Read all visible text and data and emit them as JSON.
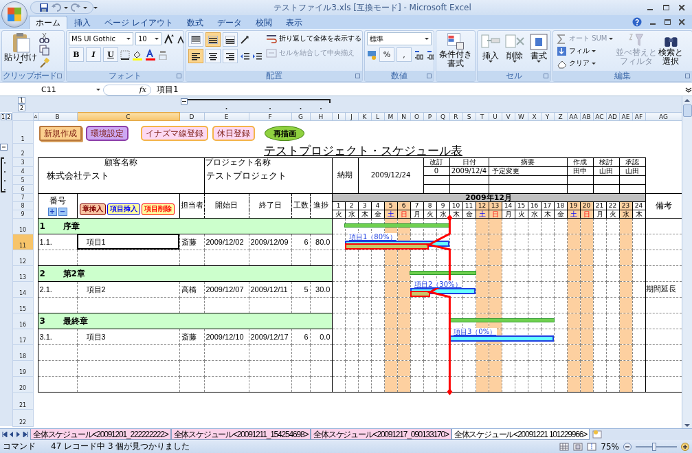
{
  "window": {
    "title": "テストファイル3.xls  [互換モード] - Microsoft Excel"
  },
  "ribbon": {
    "tabs": [
      {
        "label": "ホーム",
        "selected": true
      },
      {
        "label": "挿入",
        "selected": false
      },
      {
        "label": "ページ レイアウト",
        "selected": false
      },
      {
        "label": "数式",
        "selected": false
      },
      {
        "label": "データ",
        "selected": false
      },
      {
        "label": "校閲",
        "selected": false
      },
      {
        "label": "表示",
        "selected": false
      }
    ],
    "groups": [
      {
        "kind": "clipboard",
        "label": "クリップボード",
        "paste": "貼り付け"
      },
      {
        "kind": "font",
        "label": "フォント",
        "font_name": "MS UI Gothic",
        "font_size": "10",
        "styles": [
          "B",
          "I",
          "U"
        ]
      },
      {
        "kind": "alignment",
        "label": "配置",
        "vertical": [
          {
            "kind": "top",
            "selected": false
          },
          {
            "kind": "middle",
            "selected": true
          },
          {
            "kind": "bottom",
            "selected": false
          }
        ],
        "horizontal": [
          {
            "kind": "left",
            "selected": true
          },
          {
            "kind": "center",
            "selected": false
          },
          {
            "kind": "right",
            "selected": false
          }
        ],
        "wrap": {
          "label": "折り返して全体を表示する",
          "disabled": false
        },
        "merge": {
          "label": "セルを結合して中央揃え",
          "disabled": true
        }
      },
      {
        "kind": "number",
        "label": "数値",
        "format": "標準",
        "symbols": [
          "%",
          ","
        ]
      },
      {
        "kind": "styles",
        "button": "条件付き書式"
      },
      {
        "kind": "cells",
        "label": "セル",
        "buttons": [
          "挿入",
          "削除",
          "書式"
        ]
      },
      {
        "kind": "editing",
        "label": "編集",
        "items": [
          {
            "label": "オート SUM",
            "disabled": true
          },
          {
            "label": "フィル",
            "disabled": false
          },
          {
            "label": "クリア",
            "disabled": false
          }
        ],
        "buttons": [
          {
            "label": "並べ替えとフィルタ",
            "disabled": true
          },
          {
            "label": "検索と選択",
            "disabled": false
          }
        ]
      }
    ]
  },
  "formula_bar": {
    "name_box": "C11",
    "function_label": "fx",
    "value": "項目1"
  },
  "sheet": {
    "outline": {
      "column_levels": [
        "1",
        "2"
      ],
      "row_levels": [
        "1",
        "2"
      ]
    },
    "columns": [
      {
        "label": "A",
        "selected": false
      },
      {
        "label": "B",
        "selected": false
      },
      {
        "label": "C",
        "selected": true
      },
      {
        "label": "D",
        "selected": false
      },
      {
        "label": "E",
        "selected": false
      },
      {
        "label": "F",
        "selected": false
      },
      {
        "label": "G",
        "selected": false
      },
      {
        "label": "H",
        "selected": false
      },
      {
        "label": "I",
        "selected": false
      },
      {
        "label": "J",
        "selected": false
      },
      {
        "label": "K",
        "selected": false
      },
      {
        "label": "L",
        "selected": false
      },
      {
        "label": "M",
        "selected": false
      },
      {
        "label": "N",
        "selected": false
      },
      {
        "label": "O",
        "selected": false
      },
      {
        "label": "P",
        "selected": false
      },
      {
        "label": "Q",
        "selected": false
      },
      {
        "label": "R",
        "selected": false
      },
      {
        "label": "S",
        "selected": false
      },
      {
        "label": "T",
        "selected": false
      },
      {
        "label": "U",
        "selected": false
      },
      {
        "label": "V",
        "selected": false
      },
      {
        "label": "W",
        "selected": false
      },
      {
        "label": "X",
        "selected": false
      },
      {
        "label": "Y",
        "selected": false
      },
      {
        "label": "Z",
        "selected": false
      },
      {
        "label": "AA",
        "selected": false
      },
      {
        "label": "AB",
        "selected": false
      },
      {
        "label": "AC",
        "selected": false
      },
      {
        "label": "AD",
        "selected": false
      },
      {
        "label": "AE",
        "selected": false
      },
      {
        "label": "AF",
        "selected": false
      },
      {
        "label": "AG",
        "selected": false
      }
    ],
    "rows": [
      {
        "label": "1",
        "selected": false
      },
      {
        "label": "2",
        "selected": false
      },
      {
        "label": "3",
        "selected": false
      },
      {
        "label": "4",
        "selected": false
      },
      {
        "label": "5",
        "selected": false
      },
      {
        "label": "6",
        "selected": false
      },
      {
        "label": "7",
        "selected": false
      },
      {
        "label": "8",
        "selected": false
      },
      {
        "label": "9",
        "selected": false
      },
      {
        "label": "10",
        "selected": false
      },
      {
        "label": "11",
        "selected": true
      },
      {
        "label": "12",
        "selected": false
      },
      {
        "label": "13",
        "selected": false
      },
      {
        "label": "14",
        "selected": false
      },
      {
        "label": "15",
        "selected": false
      },
      {
        "label": "16",
        "selected": false
      },
      {
        "label": "17",
        "selected": false
      },
      {
        "label": "18",
        "selected": false
      },
      {
        "label": "19",
        "selected": false
      },
      {
        "label": "20",
        "selected": false
      },
      {
        "label": "21",
        "selected": false
      },
      {
        "label": "22",
        "selected": false
      }
    ],
    "macro_buttons": [
      {
        "label": "新規作成",
        "kind": "scroll",
        "color": "#fbd08e"
      },
      {
        "label": "環境設定",
        "kind": "rounded",
        "color": "#cda8f2"
      },
      {
        "label": "イナズマ線登録",
        "kind": "rounded",
        "color": "#fdd9f3"
      },
      {
        "label": "休日登録",
        "kind": "rounded",
        "color": "#fdd9f3"
      },
      {
        "label": "再描画",
        "kind": "ellipse",
        "color": "#8fd13f"
      }
    ],
    "title": "テストプロジェクト・スケジュール表",
    "info": {
      "customer_label": "顧客名称",
      "customer": "株式会社テスト",
      "project_label": "プロジェクト名称",
      "project": "テストプロジェクト",
      "deadline_label": "納期",
      "deadline": "2009/12/24"
    },
    "revisions": {
      "headers": [
        "改訂",
        "日付",
        "摘要",
        "作成",
        "検討",
        "承認"
      ],
      "entries": [
        [
          "0",
          "2009/12/4",
          "予定変更",
          "田中",
          "山田",
          "山田"
        ]
      ]
    },
    "task_header": {
      "number": "番号",
      "expand": "+",
      "collapse": "−",
      "row_buttons": [
        {
          "label": "章挿入",
          "kind": "chapter",
          "color": "#800000"
        },
        {
          "label": "項目挿入",
          "kind": "item",
          "color": "#0000ff"
        },
        {
          "label": "項目削除",
          "kind": "item",
          "color": "#ff0000"
        }
      ],
      "columns": [
        "担当者",
        "開始日",
        "終了日",
        "工数",
        "進捗"
      ],
      "remarks": "備考"
    },
    "calendar": {
      "month": "2009年12月",
      "days": [
        {
          "day": "1",
          "weekday": "火",
          "kind": "weekday"
        },
        {
          "day": "2",
          "weekday": "水",
          "kind": "weekday"
        },
        {
          "day": "3",
          "weekday": "木",
          "kind": "weekday"
        },
        {
          "day": "4",
          "weekday": "金",
          "kind": "weekday"
        },
        {
          "day": "5",
          "weekday": "土",
          "kind": "saturday"
        },
        {
          "day": "6",
          "weekday": "日",
          "kind": "sunday"
        },
        {
          "day": "7",
          "weekday": "月",
          "kind": "weekday"
        },
        {
          "day": "8",
          "weekday": "火",
          "kind": "weekday"
        },
        {
          "day": "9",
          "weekday": "水",
          "kind": "weekday"
        },
        {
          "day": "10",
          "weekday": "木",
          "kind": "weekday"
        },
        {
          "day": "11",
          "weekday": "金",
          "kind": "weekday"
        },
        {
          "day": "12",
          "weekday": "土",
          "kind": "saturday"
        },
        {
          "day": "13",
          "weekday": "日",
          "kind": "sunday"
        },
        {
          "day": "14",
          "weekday": "月",
          "kind": "weekday"
        },
        {
          "day": "15",
          "weekday": "火",
          "kind": "weekday"
        },
        {
          "day": "16",
          "weekday": "水",
          "kind": "weekday"
        },
        {
          "day": "17",
          "weekday": "木",
          "kind": "weekday"
        },
        {
          "day": "18",
          "weekday": "金",
          "kind": "weekday"
        },
        {
          "day": "19",
          "weekday": "土",
          "kind": "saturday"
        },
        {
          "day": "20",
          "weekday": "日",
          "kind": "sunday"
        },
        {
          "day": "21",
          "weekday": "月",
          "kind": "weekday"
        },
        {
          "day": "22",
          "weekday": "火",
          "kind": "weekday"
        },
        {
          "day": "23",
          "weekday": "水",
          "kind": "holiday"
        },
        {
          "day": "24",
          "weekday": "木",
          "kind": "weekday"
        }
      ]
    },
    "chapters": [
      {
        "number": "1",
        "name": "序章",
        "selected": false,
        "children": [
          {
            "number": "1.1.",
            "name": "項目1",
            "assignee": "斎藤",
            "start": "2009/12/02",
            "end": "2009/12/09",
            "effort": "6",
            "progress": "80.0",
            "level": 0.8,
            "bar_label": "項目1（80%）",
            "selected": true
          }
        ]
      },
      {
        "number": "2",
        "name": "第2章",
        "selected": false,
        "children": [
          {
            "number": "2.1.",
            "name": "項目2",
            "assignee": "高橋",
            "start": "2009/12/07",
            "end": "2009/12/11",
            "effort": "5",
            "progress": "30.0",
            "level": 0.3,
            "bar_label": "項目2（30%）",
            "remark": "期間延長",
            "selected": false
          }
        ]
      },
      {
        "number": "3",
        "name": "最終章",
        "selected": false,
        "children": [
          {
            "number": "3.1.",
            "name": "項目3",
            "assignee": "斎藤",
            "start": "2009/12/10",
            "end": "2009/12/17",
            "effort": "6",
            "progress": "0.0",
            "level": 0,
            "bar_label": "項目3（0%）",
            "selected": false
          }
        ]
      }
    ],
    "progress_line": {
      "shown": true
    }
  },
  "sheet_tabs": [
    {
      "label": "全体スケジュール<20091201_222222222>",
      "selected": false
    },
    {
      "label": "全体スケジュール<20091211_154254698>",
      "selected": false
    },
    {
      "label": "全体スケジュール<20091217_090133170>",
      "selected": false
    },
    {
      "label": "全体スケジュール<20091221 101229966>",
      "selected": true
    }
  ],
  "status_bar": {
    "mode": "コマンド",
    "message": "47 レコード中 3 個が見つかりました",
    "zoom": "75%",
    "zoom_level": {
      "level": 0.45
    }
  }
}
